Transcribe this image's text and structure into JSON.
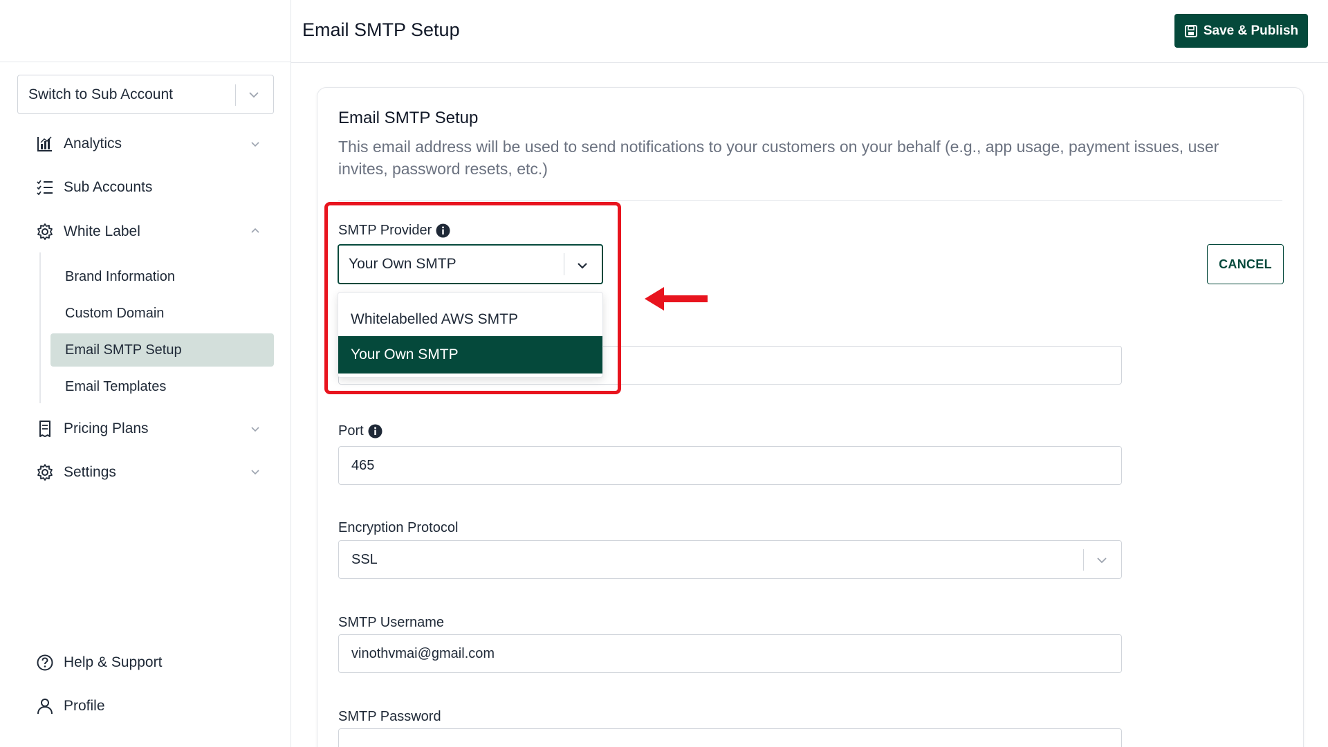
{
  "header": {
    "title": "Email SMTP Setup",
    "save_label": "Save & Publish"
  },
  "sidebar": {
    "switch_account_label": "Switch to Sub Account",
    "items": [
      {
        "label": "Analytics",
        "icon": "chart-icon"
      },
      {
        "label": "Sub Accounts",
        "icon": "checklist-icon"
      },
      {
        "label": "White Label",
        "icon": "gear-icon"
      },
      {
        "label": "Pricing Plans",
        "icon": "receipt-icon"
      },
      {
        "label": "Settings",
        "icon": "gear-icon"
      }
    ],
    "white_label_sub": [
      {
        "label": "Brand Information"
      },
      {
        "label": "Custom Domain"
      },
      {
        "label": "Email SMTP Setup"
      },
      {
        "label": "Email Templates"
      }
    ],
    "bottom_items": [
      {
        "label": "Help & Support",
        "icon": "help-circle-icon"
      },
      {
        "label": "Profile",
        "icon": "user-icon"
      }
    ]
  },
  "card": {
    "title": "Email SMTP Setup",
    "description": "This email address will be used to send notifications to your customers on your behalf (e.g., app usage, payment issues, user invites, password resets, etc.)",
    "cancel_label": "CANCEL",
    "smtp_provider": {
      "label": "SMTP Provider",
      "value": "Your Own SMTP",
      "options": [
        {
          "label": "Whitelabelled AWS SMTP",
          "selected": false
        },
        {
          "label": "Your Own SMTP",
          "selected": true
        }
      ]
    },
    "port": {
      "label": "Port",
      "value": "465"
    },
    "encryption": {
      "label": "Encryption Protocol",
      "value": "SSL"
    },
    "username": {
      "label": "SMTP Username",
      "value": "vinothvmai@gmail.com"
    },
    "password": {
      "label": "SMTP Password"
    }
  },
  "colors": {
    "brand": "#05493b",
    "active_nav_bg": "#d3dfdb",
    "annotation": "#e8141e"
  }
}
